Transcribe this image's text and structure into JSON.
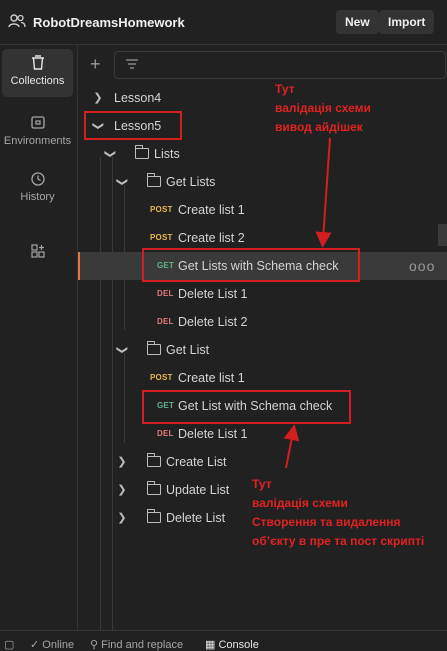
{
  "header": {
    "workspace_name": "RobotDreamsHomework",
    "new_label": "New",
    "import_label": "Import"
  },
  "rail": {
    "collections": "Collections",
    "environments": "Environments",
    "history": "History"
  },
  "tree": {
    "lesson4": "Lesson4",
    "lesson5": "Lesson5",
    "lists": "Lists",
    "get_lists": "Get Lists",
    "gl_create1": {
      "method": "POST",
      "name": "Create list 1"
    },
    "gl_create2": {
      "method": "POST",
      "name": "Create list 2"
    },
    "gl_schema": {
      "method": "GET",
      "name": "Get Lists with Schema check"
    },
    "gl_delete1": {
      "method": "DEL",
      "name": "Delete List 1"
    },
    "gl_delete2": {
      "method": "DEL",
      "name": "Delete List 2"
    },
    "get_list": "Get List",
    "g_create1": {
      "method": "POST",
      "name": "Create list 1"
    },
    "g_schema": {
      "method": "GET",
      "name": "Get List with Schema check"
    },
    "g_delete1": {
      "method": "DEL",
      "name": "Delete List 1"
    },
    "create_list": "Create List",
    "update_list": "Update List",
    "delete_list": "Delete List",
    "more_actions": "ooo"
  },
  "annotations": {
    "note1": [
      "Тут",
      "валідація схеми",
      "вивод айдішек"
    ],
    "note2": [
      "Тут",
      "валідація схеми",
      "Створення та видалення",
      "обʼєкту в пре та пост скриптi"
    ]
  },
  "statusbar": {
    "online": "Online",
    "find_replace": "Find and replace",
    "console": "Console"
  },
  "colors": {
    "accent": "#e0773d",
    "annotation_red": "#d21f1f",
    "post": "#e8b94b",
    "get": "#5fb389",
    "del": "#e07a7a"
  }
}
